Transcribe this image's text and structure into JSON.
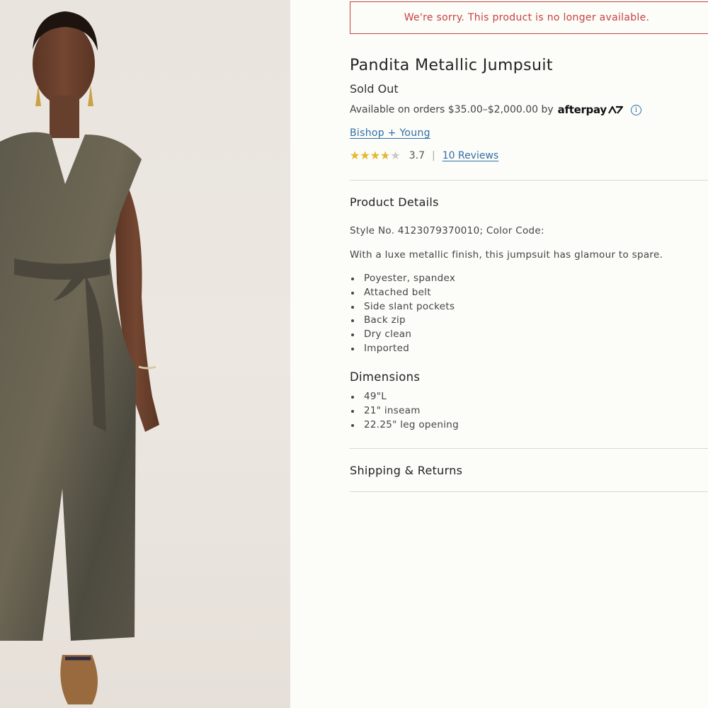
{
  "product_image": {
    "alt_icon": "model-photo"
  },
  "alert": {
    "message": "We're sorry. This product is no longer available."
  },
  "product": {
    "title": "Pandita Metallic Jumpsuit",
    "status": "Sold Out",
    "afterpay_text": "Available on orders $35.00–$2,000.00 by",
    "afterpay_logo": "afterpay",
    "brand": "Bishop + Young",
    "rating": 3.7,
    "rating_text": "3.7",
    "reviews_link": "10 Reviews"
  },
  "details": {
    "title": "Product Details",
    "style_line": "Style No. 4123079370010; Color Code:",
    "description": "With a luxe metallic finish, this jumpsuit has glamour to spare.",
    "bullets": [
      "Poyester, spandex",
      "Attached belt",
      "Side slant pockets",
      "Back zip",
      "Dry clean",
      "Imported"
    ]
  },
  "dimensions": {
    "title": "Dimensions",
    "bullets": [
      "49\"L",
      "21\" inseam",
      "22.25\" leg opening"
    ]
  },
  "shipping": {
    "title": "Shipping & Returns"
  },
  "colors": {
    "alert": "#c8423f",
    "link": "#2f6fa8",
    "star": "#e6b92c"
  }
}
